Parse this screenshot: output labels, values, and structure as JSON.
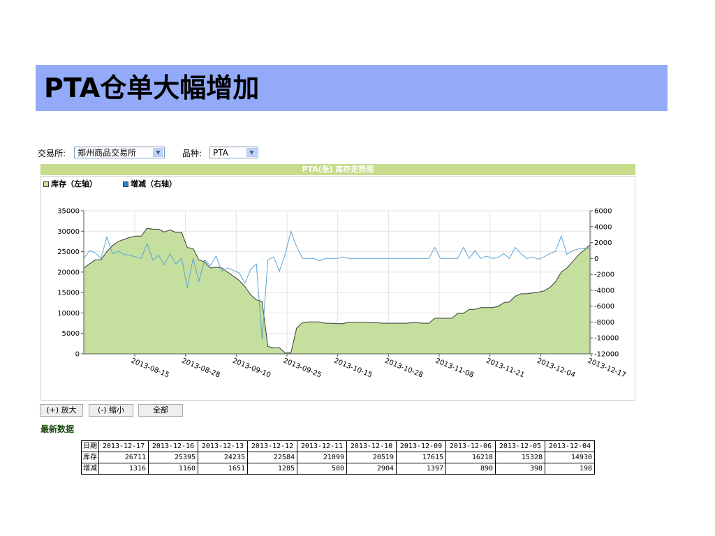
{
  "slide": {
    "title": "PTA仓单大幅增加"
  },
  "filters": {
    "exchange_label": "交易所:",
    "exchange_value": "郑州商品交易所",
    "variety_label": "品种:",
    "variety_value": "PTA"
  },
  "chart_data": {
    "type": "area",
    "title": "PTA(张) 库存走势图",
    "legend": [
      "库存（左轴）",
      "增减（右轴）"
    ],
    "legend_position": "top-left",
    "grid": true,
    "x_tick_labels": [
      "2013-08-15",
      "2013-08-28",
      "2013-09-10",
      "2013-09-25",
      "2013-10-15",
      "2013-10-28",
      "2013-11-08",
      "2013-11-21",
      "2013-12-04",
      "2013-12-17"
    ],
    "y_left": {
      "lim": [
        0,
        35000
      ],
      "ticks": [
        0,
        5000,
        10000,
        15000,
        20000,
        25000,
        30000,
        35000
      ]
    },
    "y_right": {
      "lim": [
        -12000,
        6000
      ],
      "ticks": [
        -12000,
        -10000,
        -8000,
        -6000,
        -4000,
        -2000,
        0,
        2000,
        4000,
        6000
      ]
    },
    "colors": {
      "inventory_fill": "#c5df9e",
      "inventory_line": "#3a3a3a",
      "change_line": "#5aa3d6"
    },
    "series": [
      {
        "name": "库存（左轴）",
        "axis": "left",
        "values": [
          21000,
          22000,
          23000,
          23000,
          25000,
          26500,
          27500,
          28000,
          28500,
          28800,
          28800,
          30700,
          30500,
          30500,
          29800,
          30300,
          29700,
          29700,
          26000,
          25800,
          23000,
          22500,
          21000,
          21200,
          21000,
          20000,
          19000,
          18000,
          16500,
          14500,
          13200,
          12800,
          1800,
          1500,
          1500,
          200,
          200,
          6300,
          7600,
          7800,
          7800,
          7800,
          7500,
          7500,
          7400,
          7400,
          7700,
          7700,
          7700,
          7700,
          7600,
          7600,
          7500,
          7500,
          7500,
          7500,
          7500,
          7600,
          7600,
          7500,
          7500,
          8700,
          8700,
          8700,
          8700,
          9900,
          9900,
          10900,
          10900,
          11300,
          11300,
          11300,
          11600,
          12500,
          12700,
          14100,
          14700,
          14700,
          14900,
          15100,
          15400,
          16200,
          17600,
          20000,
          21000,
          22600,
          24200,
          25400,
          26700
        ]
      },
      {
        "name": "增减（右轴）",
        "axis": "right",
        "values": [
          0,
          1000,
          700,
          0,
          2700,
          600,
          900,
          500,
          400,
          200,
          0,
          1900,
          -200,
          400,
          -800,
          600,
          -700,
          0,
          -3700,
          0,
          -2900,
          -200,
          -900,
          300,
          -1600,
          -1200,
          -1500,
          -1800,
          -3100,
          -1400,
          -700,
          -10200,
          -200,
          200,
          -1600,
          500,
          3400,
          1500,
          0,
          0,
          0,
          -300,
          0,
          0,
          0,
          200,
          0,
          0,
          0,
          0,
          0,
          0,
          0,
          0,
          0,
          0,
          0,
          0,
          0,
          0,
          0,
          1400,
          0,
          0,
          0,
          0,
          1400,
          0,
          1000,
          0,
          300,
          0,
          100,
          600,
          0,
          1400,
          600,
          0,
          200,
          -100,
          200,
          600,
          900,
          2800,
          500,
          1000,
          1200,
          1300,
          1300
        ]
      }
    ]
  },
  "buttons": {
    "zoom_in": "(+) 放大",
    "zoom_out": "(-) 缩小",
    "all": "全部"
  },
  "latest": {
    "title": "最新数据",
    "row_labels": [
      "日期",
      "库存",
      "增减"
    ],
    "dates": [
      "2013-12-17",
      "2013-12-16",
      "2013-12-13",
      "2013-12-12",
      "2013-12-11",
      "2013-12-10",
      "2013-12-09",
      "2013-12-06",
      "2013-12-05",
      "2013-12-04"
    ],
    "inventory": [
      "26711",
      "25395",
      "24235",
      "22584",
      "21099",
      "20519",
      "17615",
      "16218",
      "15328",
      "14930"
    ],
    "change": [
      "1316",
      "1160",
      "1651",
      "1285",
      "580",
      "2904",
      "1397",
      "890",
      "398",
      "198"
    ]
  }
}
